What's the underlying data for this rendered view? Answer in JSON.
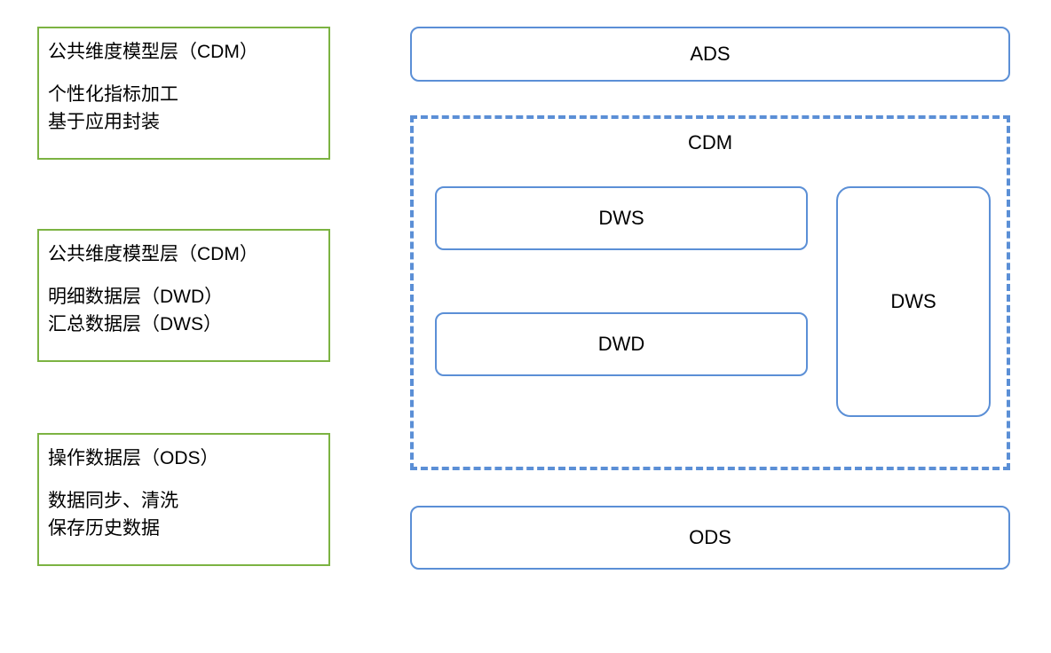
{
  "left": {
    "box1": {
      "title": "公共维度模型层（CDM）",
      "line1": "个性化指标加工",
      "line2": "基于应用封装"
    },
    "box2": {
      "title": "公共维度模型层（CDM）",
      "line1": "明细数据层（DWD）",
      "line2": "汇总数据层（DWS）"
    },
    "box3": {
      "title": "操作数据层（ODS）",
      "line1": "数据同步、清洗",
      "line2": "保存历史数据"
    }
  },
  "right": {
    "ads": "ADS",
    "cdm": {
      "title": "CDM",
      "dws_h": "DWS",
      "dwd": "DWD",
      "dws_v": "DWS"
    },
    "ods": "ODS"
  }
}
